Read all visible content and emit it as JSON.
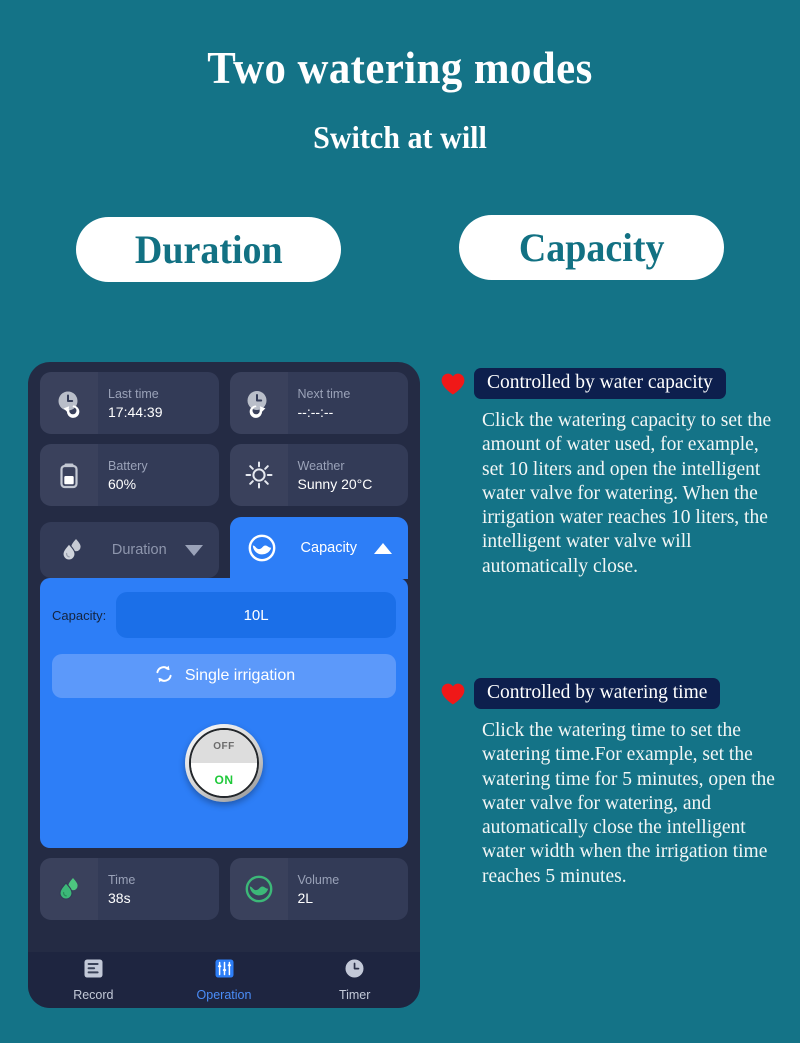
{
  "header": {
    "title": "Two watering modes",
    "subtitle": "Switch at will"
  },
  "mode_pills": [
    {
      "label": "Duration"
    },
    {
      "label": "Capacity"
    }
  ],
  "phone": {
    "stats_top": [
      {
        "icon": "clock-back-icon",
        "label": "Last time",
        "value": "17:44:39"
      },
      {
        "icon": "clock-forward-icon",
        "label": "Next time",
        "value": "--:--:--"
      },
      {
        "icon": "battery-icon",
        "label": "Battery",
        "value": "60%"
      },
      {
        "icon": "sun-icon",
        "label": "Weather",
        "value": "Sunny 20°C"
      }
    ],
    "tabs": [
      {
        "label": "Duration",
        "icon": "water-drops-icon",
        "caret": "chevron-down-icon",
        "active": false
      },
      {
        "label": "Capacity",
        "icon": "water-circle-icon",
        "caret": "chevron-up-icon",
        "active": true
      }
    ],
    "panel": {
      "capacity_label": "Capacity:",
      "capacity_value": "10L",
      "irrigation_button": "Single irrigation",
      "irrigation_icon": "loop-icon",
      "knob_off": "OFF",
      "knob_on": "ON"
    },
    "stats_bottom": [
      {
        "icon": "water-drops-green-icon",
        "label": "Time",
        "value": "38s"
      },
      {
        "icon": "water-circle-green-icon",
        "label": "Volume",
        "value": "2L"
      }
    ],
    "nav": [
      {
        "label": "Record",
        "icon": "record-list-icon",
        "active": false
      },
      {
        "label": "Operation",
        "icon": "sliders-icon",
        "active": true
      },
      {
        "label": "Timer",
        "icon": "clock-icon",
        "active": false
      }
    ]
  },
  "info_blocks": [
    {
      "badge": "Controlled by water capacity",
      "body": "Click the watering capacity to set the amount of water used, for example, set 10 liters and open the intelligent water valve for watering. When the irrigation water reaches 10 liters, the intelligent water valve will automatically close."
    },
    {
      "badge": "Controlled by watering time",
      "body": "Click the watering time to set the watering time.For example, set the watering time for 5 minutes, open the water valve for watering, and automatically close the intelligent water width when the irrigation time reaches 5 minutes."
    }
  ],
  "colors": {
    "background": "#147387",
    "accent_blue": "#2d7ef7",
    "badge_navy": "#0d1f4d",
    "heart_red": "#f01818",
    "green": "#3cb878",
    "phone_bg": "#242b44"
  }
}
